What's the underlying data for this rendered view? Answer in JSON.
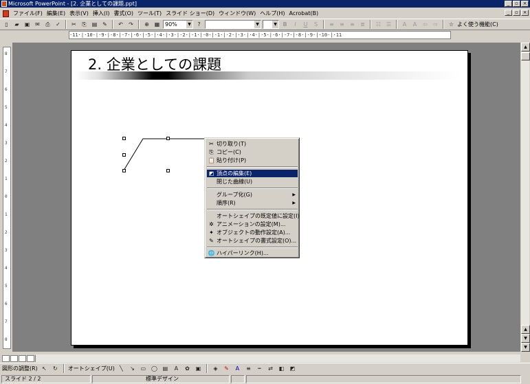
{
  "window": {
    "title": "Microsoft PowerPoint - [2. 企業としての課題.ppt]",
    "min": "_",
    "max": "▫",
    "close": "×"
  },
  "menu": {
    "items": [
      "ファイル(F)",
      "編集(E)",
      "表示(V)",
      "挿入(I)",
      "書式(O)",
      "ツール(T)",
      "スライド ショー(D)",
      "ウィンドウ(W)",
      "ヘルプ(H)",
      "Acrobat(B)"
    ]
  },
  "toolbar": {
    "zoom": "90%",
    "font": "",
    "size": "",
    "help_label": "よく使う機能(C)"
  },
  "ruler": {
    "h": "·11·|·10·|·9·|·8·|·7·|·6·|·5·|·4·|·3·|·2·|·1·|·0·|·1·|·2·|·3·|·4·|·5·|·6·|·7·|·8·|·9·|·10·|·11",
    "v": [
      "8",
      "7",
      "6",
      "5",
      "4",
      "3",
      "2",
      "1",
      "0",
      "1",
      "2",
      "3",
      "4",
      "5",
      "6",
      "7",
      "8"
    ]
  },
  "slide": {
    "title": "2. 企業としての課題"
  },
  "context_menu": {
    "items": [
      {
        "icon": "scissors-icon",
        "glyph": "✂",
        "label": "切り取り(T)"
      },
      {
        "icon": "copy-icon",
        "glyph": "⎘",
        "label": "コピー(C)"
      },
      {
        "icon": "paste-icon",
        "glyph": "📋",
        "label": "貼り付け(P)"
      },
      {
        "icon": "edit-points-icon",
        "glyph": "◩",
        "label": "頂点の編集(E)",
        "highlighted": true
      },
      {
        "label": "閉じた曲線(U)"
      },
      {
        "label": "グループ化(G)",
        "submenu": "▶"
      },
      {
        "label": "順序(R)",
        "submenu": "▶"
      },
      {
        "label": "オートシェイプの既定値に設定(I)"
      },
      {
        "icon": "animation-icon",
        "glyph": "✲",
        "label": "アニメーションの設定(M)..."
      },
      {
        "icon": "action-icon",
        "glyph": "✦",
        "label": "オブジェクトの動作設定(A)..."
      },
      {
        "icon": "format-autoshape-icon",
        "glyph": "✎",
        "label": "オートシェイプの書式設定(O)..."
      },
      {
        "icon": "hyperlink-icon",
        "glyph": "🌐",
        "label": "ハイパーリンク(H)..."
      }
    ]
  },
  "drawbar": {
    "draw_label": "図形の調整(R)",
    "autoshape_label": "オートシェイプ(U)"
  },
  "status": {
    "slide": "スライド 2 / 2",
    "design": "標準デザイン"
  }
}
